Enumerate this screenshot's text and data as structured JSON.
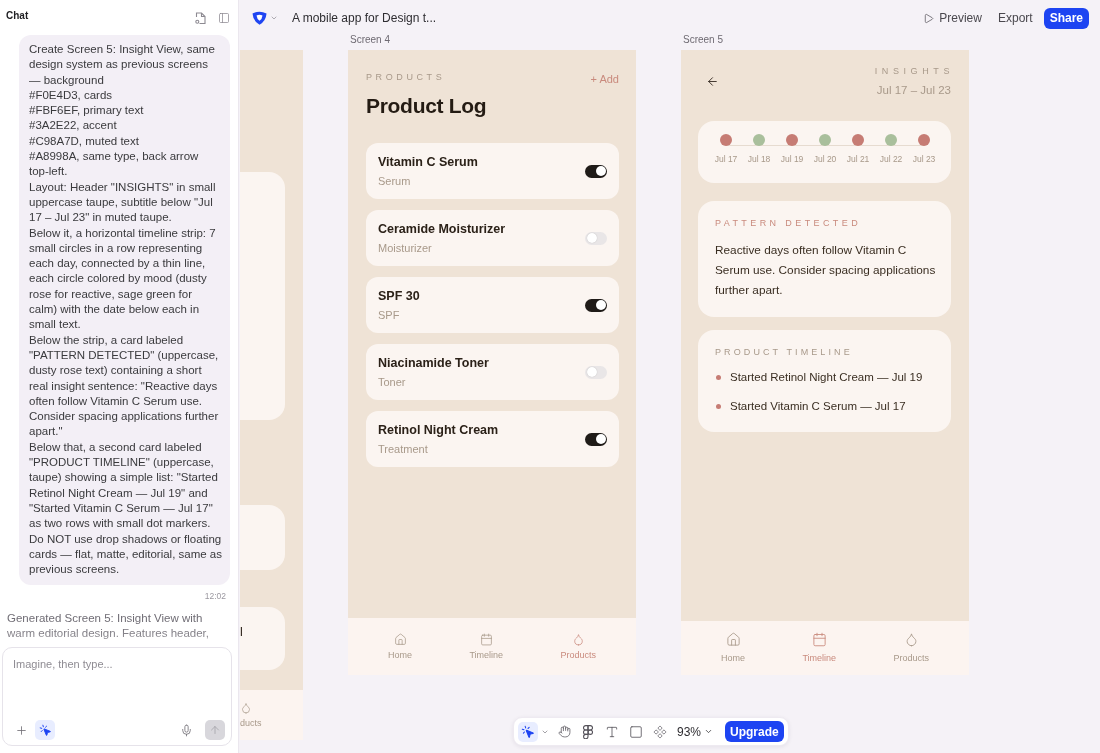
{
  "chat": {
    "title": "Chat",
    "messages": [
      {
        "kind": "user",
        "text": "Create Screen 5: Insight View, same\ndesign system as previous screens\n— background\n#F0E4D3, cards\n#FBF6EF, primary text\n#3A2E22, accent\n#C98A7D, muted text\n#A8998A, same type, back arrow\ntop-left.\nLayout: Header \"INSIGHTS\" in small\nuppercase taupe, subtitle below \"Jul\n17 – Jul 23\" in muted taupe.\nBelow it, a horizontal timeline strip: 7\nsmall circles in a row representing\neach day, connected by a thin line,\neach circle colored by mood (dusty\nrose for reactive, sage green for\ncalm) with the date below each in\nsmall text.\nBelow the strip, a card labeled\n\"PATTERN DETECTED\" (uppercase,\ndusty rose text) containing a short\nreal insight sentence: \"Reactive days\noften follow Vitamin C Serum use.\nConsider spacing applications further\napart.\"\nBelow that, a second card labeled\n\"PRODUCT TIMELINE\" (uppercase,\ntaupe) showing a simple list: \"Started\nRetinol Night Cream — Jul 19\" and\n\"Started Vitamin C Serum — Jul 17\"\nas two rows with small dot markers.\nDo NOT use drop shadows or floating\ncards — flat, matte, editorial, same as\nprevious screens.",
        "time": "12:02"
      },
      {
        "kind": "assistant",
        "text": "Generated Screen 5: Insight View with\nwarm editorial design. Features header,"
      }
    ],
    "composer": {
      "placeholder": "Imagine, then type..."
    }
  },
  "topbar": {
    "project_title": "A mobile app for Design t...",
    "actions": [
      {
        "kind": "preview",
        "label": "Preview"
      },
      {
        "kind": "plain",
        "label": "Export"
      },
      {
        "kind": "primary",
        "label": "Share"
      }
    ]
  },
  "canvas": {
    "screens": [
      {
        "kind": "partial",
        "card_text": "l",
        "nav": [
          {
            "kind": "drop",
            "label": "ducts",
            "selected": false
          }
        ]
      },
      {
        "kind": "products",
        "label": "Screen 4",
        "eyebrow": "PRODUCTS",
        "add_label": "+ Add",
        "title": "Product Log",
        "products": [
          {
            "name": "Vitamin C Serum",
            "type": "Serum",
            "on": true
          },
          {
            "name": "Ceramide Moisturizer",
            "type": "Moisturizer",
            "on": false
          },
          {
            "name": "SPF 30",
            "type": "SPF",
            "on": true
          },
          {
            "name": "Niacinamide Toner",
            "type": "Toner",
            "on": false
          },
          {
            "name": "Retinol Night Cream",
            "type": "Treatment",
            "on": true
          }
        ],
        "nav": [
          {
            "kind": "home",
            "label": "Home",
            "selected": false
          },
          {
            "kind": "calendar",
            "label": "Timeline",
            "selected": false
          },
          {
            "kind": "drop",
            "label": "Products",
            "selected": true
          }
        ]
      },
      {
        "kind": "insights",
        "label": "Screen 5",
        "eyebrow": "INSIGHTS",
        "date_range": "Jul 17 – Jul 23",
        "days": [
          {
            "date": "Jul 17",
            "color": "#c67c74"
          },
          {
            "date": "Jul 18",
            "color": "#a9bf9c"
          },
          {
            "date": "Jul 19",
            "color": "#c67c74"
          },
          {
            "date": "Jul 20",
            "color": "#a9bf9c"
          },
          {
            "date": "Jul 21",
            "color": "#c67c74"
          },
          {
            "date": "Jul 22",
            "color": "#a9bf9c"
          },
          {
            "date": "Jul 23",
            "color": "#c67c74"
          }
        ],
        "pattern": {
          "label": "PATTERN DETECTED",
          "text": "Reactive days often follow Vitamin C Serum use. Consider spacing applications further apart."
        },
        "timeline": {
          "label": "PRODUCT TIMELINE",
          "entries": [
            "Started Retinol Night Cream — Jul 19",
            "Started Vitamin C Serum — Jul 17"
          ]
        },
        "nav": [
          {
            "kind": "home",
            "label": "Home",
            "selected": false
          },
          {
            "kind": "calendar",
            "label": "Timeline",
            "selected": true
          },
          {
            "kind": "drop",
            "label": "Products",
            "selected": false
          }
        ]
      }
    ]
  },
  "toolbar": {
    "tools": [
      {
        "kind": "select",
        "selected": true
      },
      {
        "kind": "hand",
        "selected": false
      },
      {
        "kind": "shapes",
        "selected": false
      },
      {
        "kind": "text",
        "selected": false
      },
      {
        "kind": "rectangle",
        "selected": false
      },
      {
        "kind": "components",
        "selected": false
      }
    ],
    "zoom": "93%",
    "upgrade_label": "Upgrade"
  }
}
